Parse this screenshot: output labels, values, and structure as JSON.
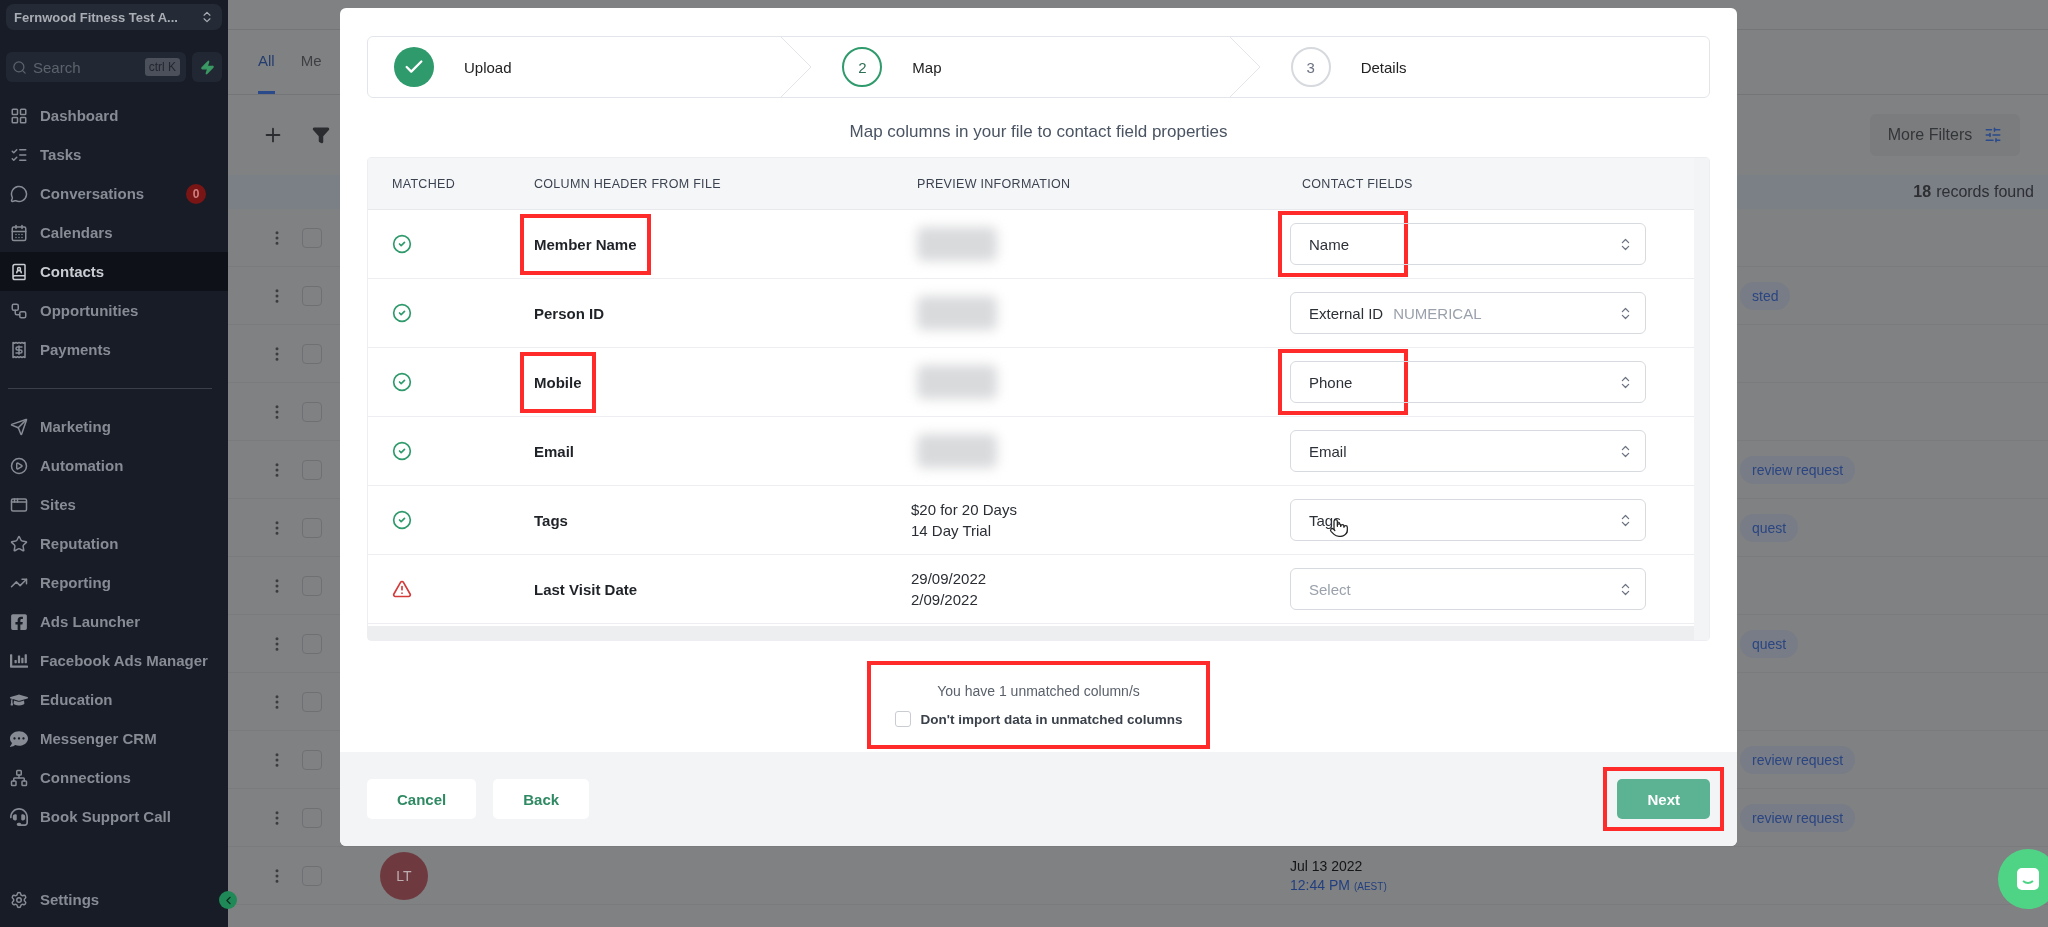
{
  "sidebar": {
    "account": "Fernwood Fitness Test A...",
    "search_placeholder": "Search",
    "shortcut": "ctrl K",
    "groups": [
      [
        {
          "label": "Dashboard",
          "selected": false
        },
        {
          "label": "Tasks",
          "selected": false
        },
        {
          "label": "Conversations",
          "selected": false,
          "badge": "0"
        },
        {
          "label": "Calendars",
          "selected": false
        },
        {
          "label": "Contacts",
          "selected": true
        },
        {
          "label": "Opportunities",
          "selected": false
        },
        {
          "label": "Payments",
          "selected": false
        }
      ],
      [
        {
          "label": "Marketing",
          "selected": false
        },
        {
          "label": "Automation",
          "selected": false
        },
        {
          "label": "Sites",
          "selected": false
        },
        {
          "label": "Reputation",
          "selected": false
        },
        {
          "label": "Reporting",
          "selected": false
        },
        {
          "label": "Ads Launcher",
          "selected": false
        },
        {
          "label": "Facebook Ads Manager",
          "selected": false
        },
        {
          "label": "Education",
          "selected": false
        },
        {
          "label": "Messenger CRM",
          "selected": false
        },
        {
          "label": "Connections",
          "selected": false
        },
        {
          "label": "Book Support Call",
          "selected": false
        }
      ]
    ],
    "footer": "Settings"
  },
  "tabs": [
    {
      "label": "All",
      "selected": true
    },
    {
      "label": "Me",
      "selected": false
    }
  ],
  "more_filters": "More Filters",
  "records": {
    "count": "18",
    "label": "records found"
  },
  "rows": [
    {
      "checked": false
    },
    {
      "checked": false,
      "tag": "sted"
    },
    {
      "checked": false
    },
    {
      "checked": false
    },
    {
      "checked": false,
      "tag": "review request"
    },
    {
      "checked": false,
      "tag": "quest"
    },
    {
      "checked": false
    },
    {
      "checked": false,
      "tag": "quest"
    },
    {
      "checked": false
    },
    {
      "checked": false,
      "tag": "review request"
    },
    {
      "checked": false,
      "tag": "review request"
    },
    {
      "checked": false,
      "avatar": "LT",
      "date": "Jul 13 2022",
      "time": "12:44 PM",
      "zone": "(AEST)"
    }
  ],
  "modal": {
    "steps": [
      {
        "label": "Upload",
        "done": true,
        "selected": false
      },
      {
        "label": "Map",
        "number": "2",
        "done": false,
        "selected": true
      },
      {
        "label": "Details",
        "number": "3",
        "done": false,
        "selected": false
      }
    ],
    "subtitle": "Map columns in your file to contact field properties",
    "columns": [
      "MATCHED",
      "COLUMN HEADER FROM FILE",
      "PREVIEW INFORMATION",
      "CONTACT FIELDS"
    ],
    "mappings": [
      {
        "matched": true,
        "header": "Member Name",
        "header_highlighted": true,
        "preview_blurred": true,
        "field": "Name",
        "field_highlighted": true
      },
      {
        "matched": true,
        "header": "Person ID",
        "header_highlighted": false,
        "preview_blurred": true,
        "field": "External ID",
        "field_type": "NUMERICAL",
        "field_highlighted": false
      },
      {
        "matched": true,
        "header": "Mobile",
        "header_highlighted": true,
        "preview_blurred": true,
        "field": "Phone",
        "field_highlighted": true
      },
      {
        "matched": true,
        "header": "Email",
        "header_highlighted": false,
        "preview_blurred": true,
        "field": "Email",
        "field_highlighted": false
      },
      {
        "matched": true,
        "header": "Tags",
        "header_highlighted": false,
        "preview": [
          "$20 for 20 Days",
          "14 Day Trial"
        ],
        "field": "Tags",
        "field_highlighted": false,
        "pointer": true
      },
      {
        "matched": false,
        "header": "Last Visit Date",
        "header_highlighted": false,
        "preview": [
          "29/09/2022",
          "2/09/2022"
        ],
        "field_placeholder": "Select",
        "field_highlighted": false
      }
    ],
    "unmatched": {
      "text": "You have 1 unmatched column/s",
      "checkbox_label": "Don't import data in unmatched columns",
      "checked": false,
      "highlighted": true
    },
    "buttons": {
      "cancel": "Cancel",
      "back": "Back",
      "next": "Next",
      "next_highlighted": true
    }
  }
}
